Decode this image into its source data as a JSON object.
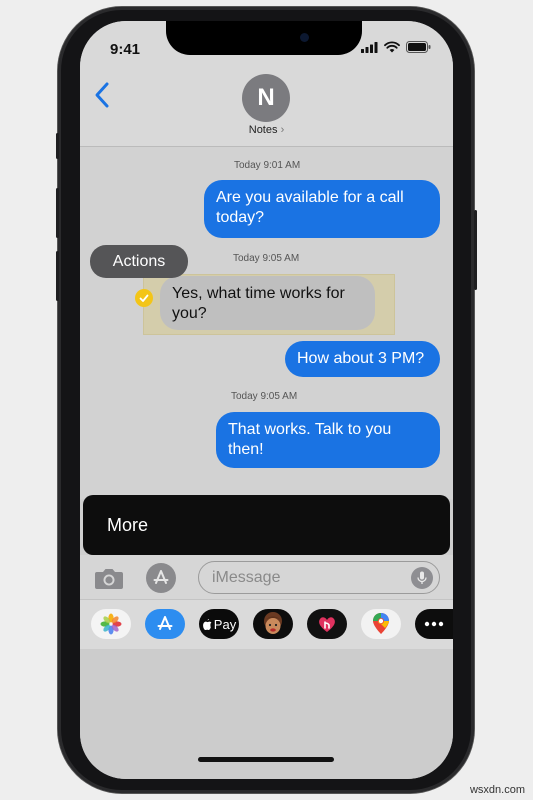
{
  "status_bar": {
    "time": "9:41"
  },
  "header": {
    "avatar_initial": "N",
    "contact_name": "Notes",
    "contact_chevron": "›"
  },
  "messages": [
    {
      "timestamp": "Today 9:01 AM"
    },
    {
      "direction": "outgoing",
      "text_line1": "Are you available for a call",
      "text_line2": "today?"
    },
    {
      "timestamp": "Today 9:05 AM"
    },
    {
      "direction": "incoming",
      "text_line1": "Yes, what time works for",
      "text_line2": "you?",
      "selected": true
    },
    {
      "direction": "outgoing",
      "text_line1": "How about 3 PM?"
    },
    {
      "timestamp": "Today 9:05 AM"
    },
    {
      "direction": "outgoing",
      "text_line1": "That works. Talk to you",
      "text_line2": "then!"
    }
  ],
  "actions_label": "Actions",
  "more_label": "More",
  "compose": {
    "placeholder": "iMessage"
  },
  "app_strip": {
    "items": [
      {
        "name": "photos-app",
        "icon": "photos-icon"
      },
      {
        "name": "app-store",
        "icon": "app-store-icon"
      },
      {
        "name": "apple-pay",
        "icon": "apple-pay-icon",
        "label": "Pay"
      },
      {
        "name": "memoji",
        "icon": "memoji-icon"
      },
      {
        "name": "digital-touch",
        "icon": "digital-touch-icon"
      },
      {
        "name": "maps-app",
        "icon": "maps-icon"
      },
      {
        "name": "more-apps",
        "icon": "ellipsis-icon"
      }
    ]
  },
  "watermark": "wsxdn.com",
  "colors": {
    "outgoing_bubble": "#1a73e3",
    "incoming_bubble": "#bfbfbf",
    "more_bar": "#0d0d0d",
    "check": "#f3c517",
    "back_arrow": "#1a73e3"
  }
}
